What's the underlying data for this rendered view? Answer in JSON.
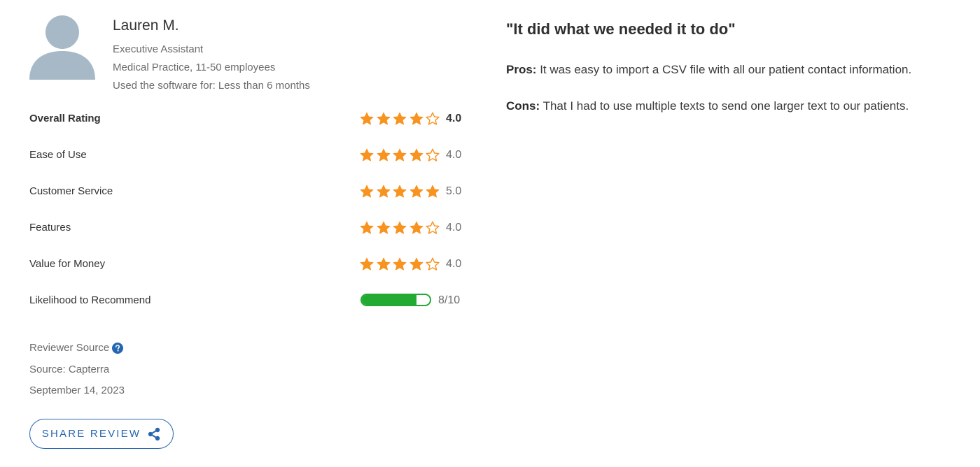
{
  "reviewer": {
    "name": "Lauren M.",
    "role": "Executive Assistant",
    "company": "Medical Practice, 11-50 employees",
    "usage": "Used the software for: Less than 6 months"
  },
  "ratings": [
    {
      "label": "Overall Rating",
      "stars": 4,
      "score": "4.0"
    },
    {
      "label": "Ease of Use",
      "stars": 4,
      "score": "4.0"
    },
    {
      "label": "Customer Service",
      "stars": 5,
      "score": "5.0"
    },
    {
      "label": "Features",
      "stars": 4,
      "score": "4.0"
    },
    {
      "label": "Value for Money",
      "stars": 4,
      "score": "4.0"
    }
  ],
  "recommend": {
    "label": "Likelihood to Recommend",
    "value": 8,
    "max": 10,
    "score_text": "8/10"
  },
  "source": {
    "heading": "Reviewer Source",
    "source_text": "Source: Capterra",
    "date": "September 14, 2023"
  },
  "share": {
    "label": "SHARE REVIEW"
  },
  "review": {
    "title": "\"It did what we needed it to do\"",
    "pros_label": "Pros:",
    "pros_text": "It was easy to import a CSV file with all our patient contact information.",
    "cons_label": "Cons:",
    "cons_text": "That I had to use multiple texts to send one larger text to our patients."
  },
  "colors": {
    "star": "#f7931e",
    "progress": "#22aa33",
    "accent": "#2566b0",
    "avatar": "#a7b9c6"
  },
  "icons": {
    "avatar": "user-avatar-icon",
    "star_filled": "star-filled-icon",
    "star_empty": "star-outline-icon",
    "help": "question-circle-icon",
    "share": "share-icon"
  }
}
